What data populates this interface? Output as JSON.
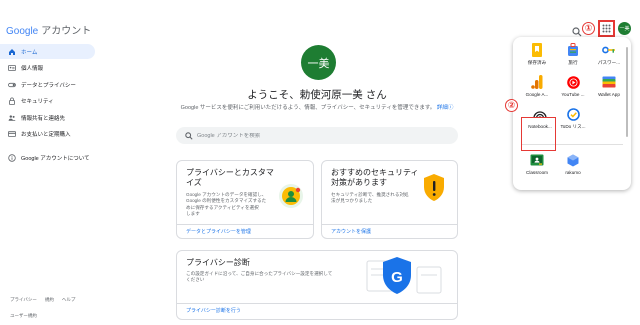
{
  "header": {
    "logo_google": "Google",
    "logo_suffix": "アカウント",
    "avatar_initials": "一美"
  },
  "annotations": {
    "step1": "①",
    "step2": "②"
  },
  "sidebar": {
    "items": [
      {
        "label": "ホーム",
        "icon": "home-icon",
        "active": true
      },
      {
        "label": "個人情報",
        "icon": "id-card-icon"
      },
      {
        "label": "データとプライバシー",
        "icon": "toggle-icon"
      },
      {
        "label": "セキュリティ",
        "icon": "lock-icon"
      },
      {
        "label": "情報共有と連絡先",
        "icon": "people-icon"
      },
      {
        "label": "お支払いと定期購入",
        "icon": "credit-card-icon"
      },
      {
        "label": "Google アカウントについて",
        "icon": "info-icon"
      }
    ],
    "footer": [
      "プライバシー",
      "規約",
      "ヘルプ"
    ],
    "footer_terms": "ユーザー規約"
  },
  "main": {
    "avatar": "一美",
    "welcome": "ようこそ、勅使河原一美 さん",
    "subtitle": "Google サービスを便利にご利用いただけるよう、情報、プライバシー、セキュリティを管理できます。",
    "subtitle_link": "詳細",
    "search_placeholder": "Google アカウントを検索",
    "cards": {
      "privacy": {
        "title_line1": "プライバシーとカスタマ",
        "title_line2": "イズ",
        "desc": [
          "Google アカウントのデータを確認し、",
          "Google の利便性をカスタマイズするた",
          "めに保存するアクティビティを選択",
          "します"
        ],
        "link": "データとプライバシーを管理"
      },
      "security": {
        "title_line1": "おすすめのセキュリティ",
        "title_line2": "対策があります",
        "desc": [
          "セキュリティ診断で、推奨される対処",
          "法が見つかりました"
        ],
        "link": "アカウントを保護"
      },
      "checkup": {
        "title": "プライバシー診断",
        "desc": [
          "この設定ガイドに沿って、ご自身に合ったプライバシー設定を選択して",
          "ください"
        ],
        "link": "プライバシー診断を行う"
      }
    }
  },
  "apps_panel": {
    "apps": [
      {
        "label": "保存済み",
        "icon": "bookmark-icon",
        "color": "#fbbc04"
      },
      {
        "label": "旅行",
        "icon": "suitcase-icon",
        "color": "#4285f4"
      },
      {
        "label": "パスワー...",
        "icon": "key-icon",
        "color": "#1a73e8"
      },
      {
        "label": "Google A...",
        "icon": "analytics-icon",
        "color": "#f9ab00"
      },
      {
        "label": "YouTube ...",
        "icon": "youtube-music-icon",
        "color": "#ff0000"
      },
      {
        "label": "Wallet App",
        "icon": "wallet-icon",
        "color": "#3c4043"
      },
      {
        "label": "Notebook...",
        "icon": "notebook-icon",
        "color": "#202124"
      },
      {
        "label": "ToDo リス...",
        "icon": "tasks-icon",
        "color": "#1a73e8"
      },
      {
        "label": "Classroom",
        "icon": "classroom-icon",
        "color": "#1e8e3e"
      },
      {
        "label": "rakumo",
        "icon": "rakumo-icon",
        "color": "#4285f4"
      }
    ]
  },
  "colors": {
    "accent": "#1a73e8",
    "active_nav_bg": "#e8f0fe",
    "avatar_bg": "#1e7d32",
    "annotation_red": "#e53935"
  }
}
